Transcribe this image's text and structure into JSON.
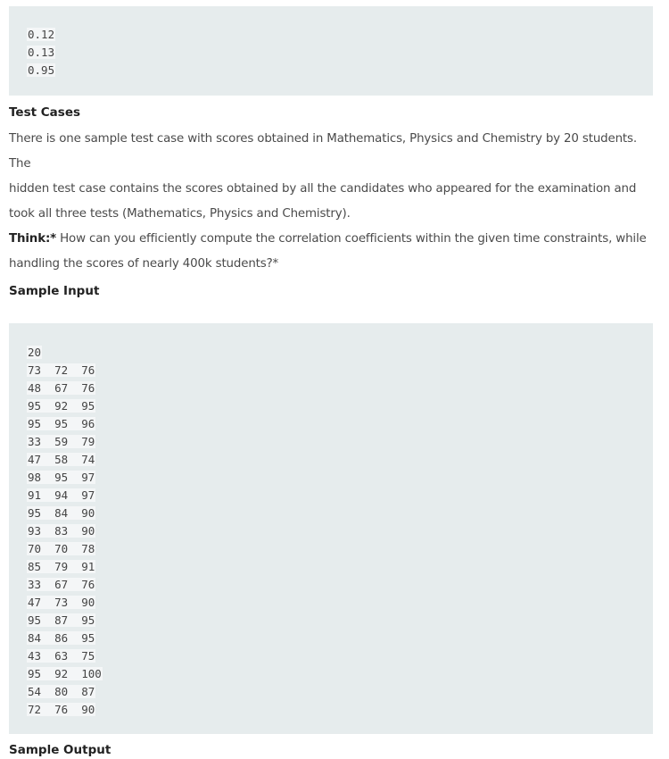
{
  "top_output": {
    "lines": [
      "0.12",
      "0.13",
      "0.95"
    ]
  },
  "test_cases": {
    "heading": "Test Cases",
    "line1": "There is one sample test case with scores obtained in Mathematics, Physics and Chemistry by 20 students. The",
    "line2": "hidden test case contains the scores obtained by all the candidates who appeared for the examination and",
    "line3": "took all three tests (Mathematics, Physics and Chemistry).",
    "think_label": "Think:*",
    "think_line1": " How can you efficiently compute the correlation coefficients within the given time constraints, while",
    "think_line2": "handling the scores of nearly 400k students?*"
  },
  "sample_input": {
    "heading": "Sample Input",
    "lines": [
      "20",
      "73  72  76",
      "48  67  76",
      "95  92  95",
      "95  95  96",
      "33  59  79",
      "47  58  74",
      "98  95  97",
      "91  94  97",
      "95  84  90",
      "93  83  90",
      "70  70  78",
      "85  79  91",
      "33  67  76",
      "47  73  90",
      "95  87  95",
      "84  86  95",
      "43  63  75",
      "95  92  100",
      "54  80  87",
      "72  76  90"
    ]
  },
  "sample_output": {
    "heading": "Sample Output"
  }
}
